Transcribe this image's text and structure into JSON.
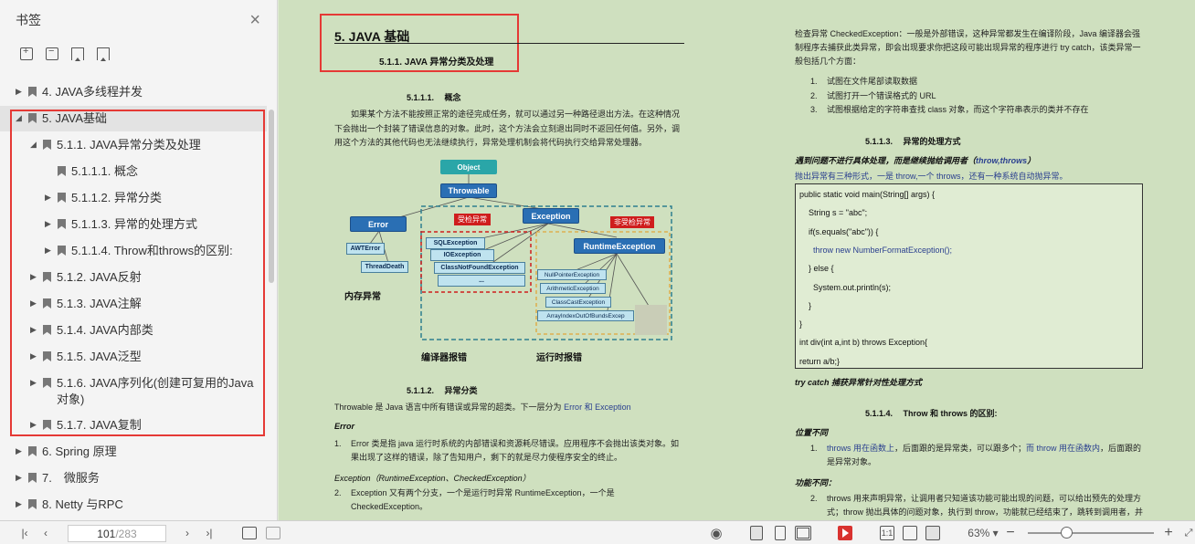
{
  "sidebar": {
    "title": "书签",
    "close_icon": "×",
    "tools": [
      "expand-all-icon",
      "collapse-all-icon",
      "add-bookmark-icon",
      "bookmark-icon"
    ],
    "items": [
      {
        "label": "4. JAVA多线程并发",
        "arrow": "▶",
        "level": 0
      },
      {
        "label": "5. JAVA基础",
        "arrow": "◢",
        "level": 0,
        "selected": true
      },
      {
        "label": "5.1.1. JAVA异常分类及处理",
        "arrow": "◢",
        "level": 1
      },
      {
        "label": "5.1.1.1. 概念",
        "arrow": "",
        "level": 2
      },
      {
        "label": "5.1.1.2. 异常分类",
        "arrow": "▶",
        "level": 2
      },
      {
        "label": "5.1.1.3. 异常的处理方式",
        "arrow": "▶",
        "level": 2
      },
      {
        "label": "5.1.1.4. Throw和throws的区别:",
        "arrow": "▶",
        "level": 2
      },
      {
        "label": "5.1.2. JAVA反射",
        "arrow": "▶",
        "level": 1
      },
      {
        "label": "5.1.3. JAVA注解",
        "arrow": "▶",
        "level": 1
      },
      {
        "label": "5.1.4. JAVA内部类",
        "arrow": "▶",
        "level": 1
      },
      {
        "label": "5.1.5. JAVA泛型",
        "arrow": "▶",
        "level": 1
      },
      {
        "label": "5.1.6. JAVA序列化(创建可复用的Java对象)",
        "arrow": "▶",
        "level": 1
      },
      {
        "label": "5.1.7. JAVA复制",
        "arrow": "▶",
        "level": 1
      },
      {
        "label": "6. Spring 原理",
        "arrow": "▶",
        "level": 0
      },
      {
        "label": "7.　微服务",
        "arrow": "▶",
        "level": 0
      },
      {
        "label": "8. Netty 与RPC",
        "arrow": "▶",
        "level": 0
      }
    ]
  },
  "doc": {
    "h1": "5. JAVA 基础",
    "h2": "5.1.1. JAVA 异常分类及处理",
    "s1_title": "5.1.1.1.　 概念",
    "s1_text": "如果某个方法不能按照正常的途径完成任务，就可以通过另一种路径退出方法。在这种情况下会抛出一个封装了错误信息的对象。此时，这个方法会立刻退出同时不返回任何值。另外，调用这个方法的其他代码也无法继续执行，异常处理机制会将代码执行交给异常处理器。",
    "diagram": {
      "object": "Object",
      "throwable": "Throwable",
      "error": "Error",
      "exception": "Exception",
      "checked_tag": "受检异常",
      "unchecked_tag": "非受检异常",
      "runtime": "RuntimeException",
      "awt": "AWTError",
      "threaddeath": "ThreadDeath",
      "sql": "SQLException",
      "io": "IOException",
      "cnf": "ClassNotFoundException",
      "ellipsis": "...",
      "npe": "NullPointerException",
      "arith": "ArithmeticException",
      "cce": "ClassCastException",
      "aioobe": "ArrayIndexOutOfBundsExcep",
      "mem_label": "内存异常",
      "compile_label": "编译器报错",
      "runtime_label": "运行时报错"
    },
    "s2_title": "5.1.1.2.　 异常分类",
    "s2_intro": "Throwable 是 Java 语言中所有错误或异常的超类。下一层分为",
    "s2_intro_blue": "Error 和 Exception",
    "error_head": "Error",
    "error_item_no": "1.",
    "error_item": "Error 类是指 java 运行时系统的内部错误和资源耗尽错误。应用程序不会抛出该类对象。如果出现了这样的错误，除了告知用户，剩下的就是尽力使程序安全的终止。",
    "exc_head": "Exception（RuntimeException、CheckedException）",
    "exc_item_no": "2.",
    "exc_item": "Exception 又有两个分支，一个是运行时异常 RuntimeException，一个是CheckedException。",
    "checked_text": "检查异常 CheckedException：一般是外部错误，这种异常都发生在编译阶段，Java 编译器会强制程序去捕获此类异常，即会出现要求你把这段可能出现异常的程序进行 try catch，该类异常一般包括几个方面：",
    "checked_list": [
      {
        "no": "1.",
        "text": "试图在文件尾部读取数据"
      },
      {
        "no": "2.",
        "text": "试图打开一个错误格式的 URL"
      },
      {
        "no": "3.",
        "text": "试图根据给定的字符串查找 class 对象，而这个字符串表示的类并不存在"
      }
    ],
    "s3_title": "5.1.1.3.　 异常的处理方式",
    "s3_em": "遇到问题不进行具体处理，而是继续抛给调用者（",
    "s3_em_blue": "throw,throws",
    "s3_em_end": "）",
    "s3_text": "抛出异常有三种形式，一是 throw,一个 throws，还有一种系统自动抛异常。",
    "code": [
      "public static void main(String[] args) {",
      "    String s = \"abc\";",
      "    if(s.equals(\"abc\")) {",
      "      throw new NumberFormatException();",
      "    } else {",
      "      System.out.println(s);",
      "    }",
      "}",
      "int div(int a,int b) throws Exception{",
      "return a/b;}"
    ],
    "try_catch": "try catch 捕获异常针对性处理方式",
    "s4_title": "5.1.1.4.　 Throw 和 throws 的区别:",
    "pos_head": "位置不同",
    "pos_no": "1.",
    "pos_blue1": "throws 用在函数上",
    "pos_text1": "，后面跟的是异常类，可以跟多个；",
    "pos_blue2": "而 throw 用在函数内",
    "pos_text2": "，后面跟的是异常对象。",
    "func_head": "功能不同：",
    "func_no": "2.",
    "func_text": "throws 用来声明异常，让调用者只知道该功能可能出现的问题，可以给出预先的处理方式；throw 抛出具体的问题对象，执行到 throw，功能就已经结束了，跳转到调用者，并"
  },
  "bottom": {
    "page_current": "101",
    "page_total": "/283",
    "zoom": "63%"
  }
}
